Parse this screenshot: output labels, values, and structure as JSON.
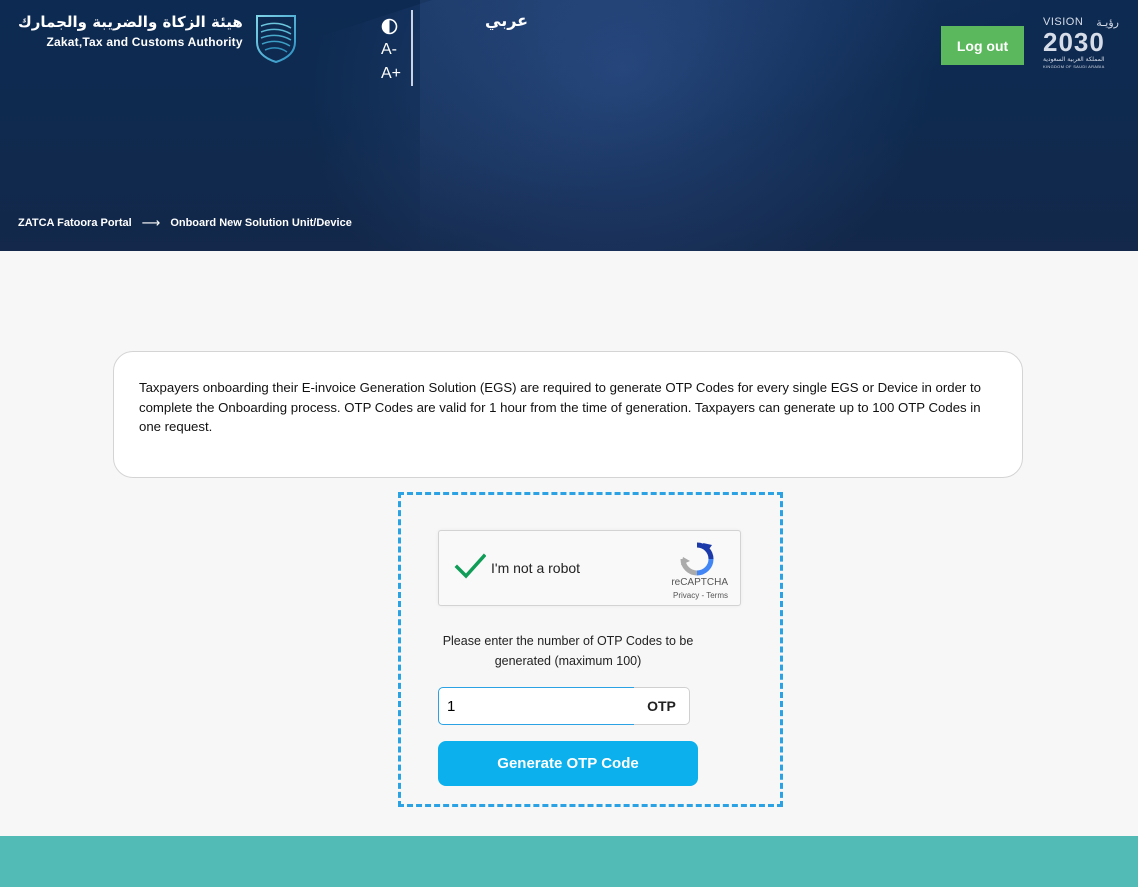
{
  "header": {
    "logo_ar": "هيئة الزكاة والضريبة والجمارك",
    "logo_en": "Zakat,Tax and Customs Authority",
    "a11y": {
      "contrast_icon": "contrast-icon",
      "decrease": "A-",
      "increase": "A+"
    },
    "language": "عربي",
    "logout_label": "Log out",
    "vision": {
      "top_en": "VISION",
      "top_ar": "رؤيـة",
      "number": "2030",
      "sub_ar": "المملكة العربية السعودية",
      "sub_en": "KINGDOM OF SAUDI ARABIA"
    },
    "breadcrumb": {
      "home": "ZATCA Fatoora Portal",
      "current": "Onboard New Solution Unit/Device"
    }
  },
  "info": {
    "text": "Taxpayers onboarding their E-invoice Generation Solution (EGS) are required to generate OTP Codes for every single EGS or Device in order to complete the Onboarding process. OTP Codes are valid for 1 hour from the time of generation. Taxpayers can generate up to 100 OTP Codes in one request."
  },
  "captcha": {
    "label": "I'm not a robot",
    "brand": "reCAPTCHA",
    "links": "Privacy - Terms",
    "checked": true
  },
  "otp_form": {
    "prompt": "Please enter the number of OTP Codes to be generated (maximum 100)",
    "value": "1",
    "suffix": "OTP",
    "button_label": "Generate OTP Code"
  },
  "colors": {
    "header_bg": "#0e2a4f",
    "logout_bg": "#5cb85c",
    "accent": "#0bb0ec",
    "dashed_border": "#2aa2e3",
    "footer_bg": "#52bbb6"
  }
}
